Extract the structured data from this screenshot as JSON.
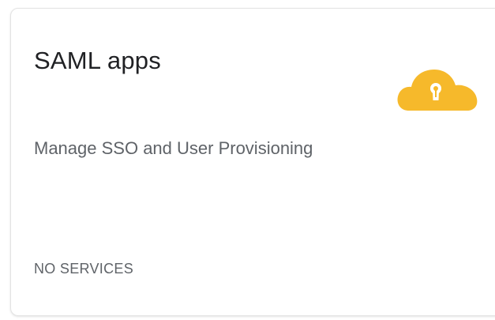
{
  "card": {
    "title": "SAML apps",
    "subtitle": "Manage SSO and User Provisioning",
    "status": "NO SERVICES",
    "icon": "cloud-lock-icon",
    "accent_color": "#F6B92B"
  }
}
